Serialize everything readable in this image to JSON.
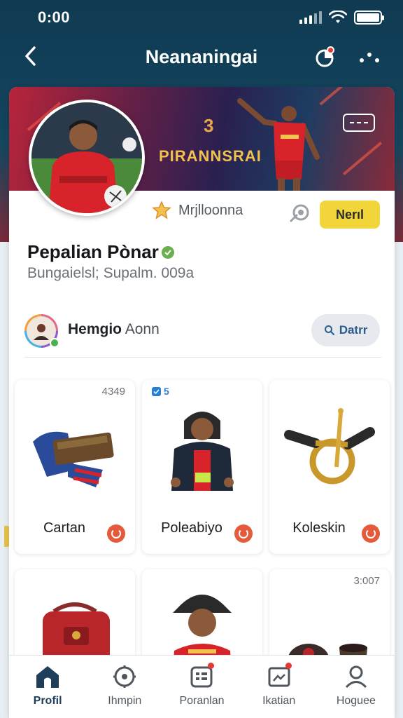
{
  "status_bar": {
    "time": "0:00"
  },
  "nav": {
    "title": "Neananingai"
  },
  "banner": {
    "number": "3",
    "text": "PIRANNSRAI"
  },
  "profile": {
    "rank_label": "Mrjlloonna",
    "follow_label": "Nerıl",
    "name": "Pepalian Pònar",
    "subtitle": "Bungaielsl; Supalm. 009a"
  },
  "friend": {
    "name_bold": "Hemgio",
    "name_rest": "Aonn",
    "search_label": "Datrr"
  },
  "items": [
    {
      "label": "Cartan",
      "count": "4349",
      "badge": ""
    },
    {
      "label": "Poleabiyo",
      "count": "",
      "badge": "5"
    },
    {
      "label": "Koleskin",
      "count": "",
      "badge": ""
    },
    {
      "label": "",
      "count": "",
      "badge": ""
    },
    {
      "label": "",
      "count": "",
      "badge": ""
    },
    {
      "label": "",
      "count": "3:007",
      "badge": ""
    }
  ],
  "tabs": [
    {
      "label": "Profil",
      "icon": "home-icon"
    },
    {
      "label": "Ihmpin",
      "icon": "compass-icon"
    },
    {
      "label": "Poranlan",
      "icon": "calendar-icon"
    },
    {
      "label": "Ikatian",
      "icon": "image-icon"
    },
    {
      "label": "Hoguee",
      "icon": "user-icon"
    }
  ],
  "colors": {
    "header": "#0f3a52",
    "follow": "#f2d53a",
    "accent_red": "#e53935",
    "active_tab": "#1f3e5a"
  }
}
